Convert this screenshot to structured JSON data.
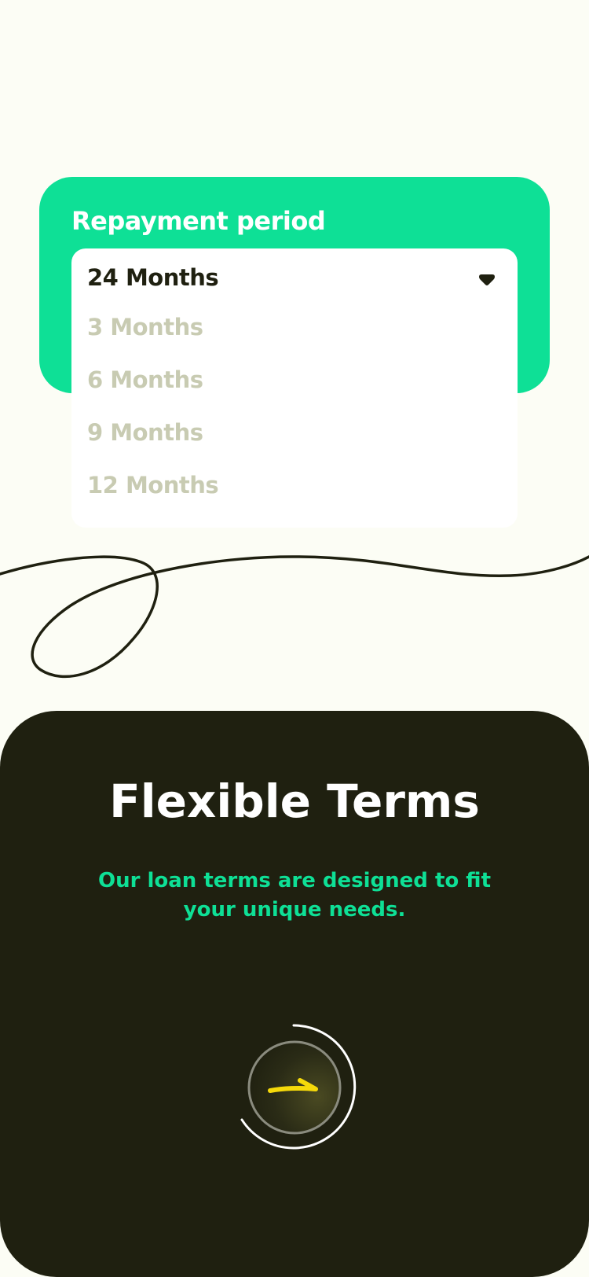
{
  "repayment": {
    "label": "Repayment period",
    "selected": "24 Months",
    "options": [
      "3 Months",
      "6 Months",
      "9 Months",
      "12 Months"
    ]
  },
  "feature": {
    "title": "Flexible Terms",
    "description": "Our loan terms are designed to fit your unique needs."
  },
  "colors": {
    "accent": "#0ee096",
    "dark": "#1f2010",
    "background": "#fcfdf5",
    "muted_option": "#c8cbb2",
    "arrow": "#f5d90a"
  },
  "icons": {
    "dropdown": "caret-down-icon",
    "next": "arrow-right-icon",
    "progress": "progress-ring-icon"
  }
}
